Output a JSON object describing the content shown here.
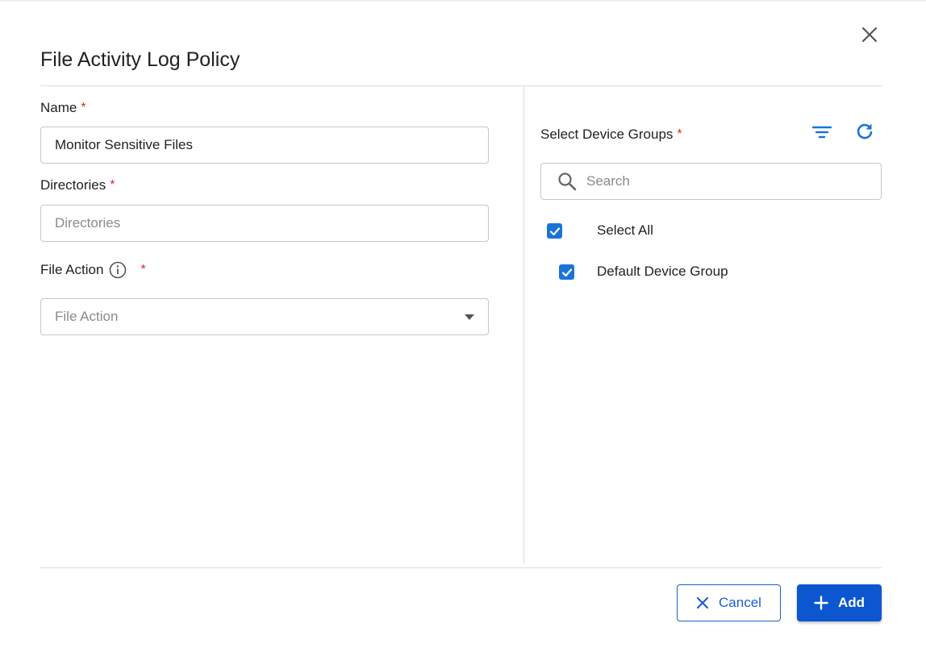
{
  "dialog": {
    "title": "File Activity Log Policy"
  },
  "form": {
    "name": {
      "label": "Name",
      "required_mark": "*",
      "value": "Monitor Sensitive Files"
    },
    "directories": {
      "label": "Directories",
      "required_mark": "*",
      "placeholder": "Directories"
    },
    "file_action": {
      "label": "File Action",
      "required_mark": "*",
      "placeholder": "File Action"
    }
  },
  "device_groups": {
    "label": "Select Device Groups",
    "required_mark": "*",
    "search_placeholder": "Search",
    "items": [
      {
        "label": "Select All",
        "checked": true
      },
      {
        "label": "Default Device Group",
        "checked": true
      }
    ]
  },
  "footer": {
    "cancel_label": "Cancel",
    "add_label": "Add"
  },
  "colors": {
    "accent": "#1a73d9",
    "primary_button": "#0c57d0",
    "required": "#d32f2f"
  },
  "icons": {
    "close": "close-icon",
    "info": "info-icon",
    "filter": "filter-icon",
    "refresh": "refresh-icon",
    "search": "search-icon",
    "check": "check-icon",
    "plus": "plus-icon"
  }
}
